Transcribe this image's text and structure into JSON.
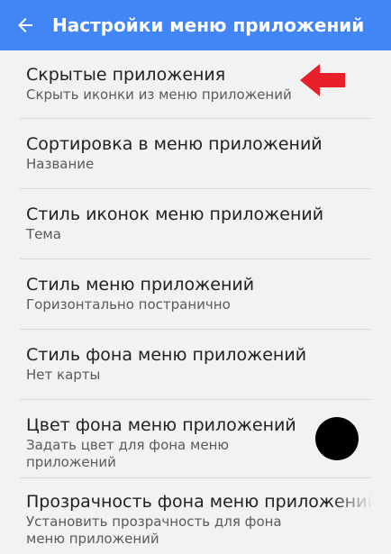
{
  "appbar": {
    "title": "Настройки меню приложений",
    "back_icon": "arrow-left-icon",
    "color": "#4285f4"
  },
  "settings": [
    {
      "title": "Скрытые приложения",
      "summary": "Скрыть иконки из меню приложений"
    },
    {
      "title": "Сортировка в меню приложений",
      "summary": "Название"
    },
    {
      "title": "Стиль иконок меню приложений",
      "summary": "Тема"
    },
    {
      "title": "Стиль меню приложений",
      "summary": "Горизонтально постранично"
    },
    {
      "title": "Стиль фона меню приложений",
      "summary": "Нет карты"
    },
    {
      "title": "Цвет фона меню приложений",
      "summary": "Задать цвет для фона меню приложений"
    },
    {
      "title": "Прозрачность фона меню приложений",
      "summary": "Установить прозрачность для фона меню приложений"
    }
  ],
  "annotation": {
    "arrow_icon": "red-arrow-left-icon",
    "arrow_color": "#e8202a",
    "dot_color": "#000000"
  }
}
